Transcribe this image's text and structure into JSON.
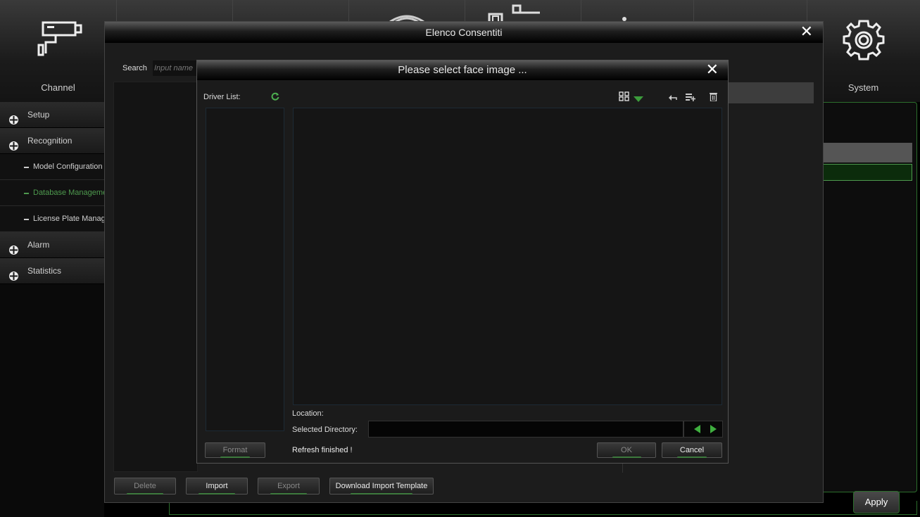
{
  "nav": {
    "channel_label": "Channel",
    "system_label": "System"
  },
  "sidebar": {
    "items": [
      {
        "label": "Setup"
      },
      {
        "label": "Recognition"
      },
      {
        "label": "Model Configuration"
      },
      {
        "label": "Database Management"
      },
      {
        "label": "License Plate Management"
      },
      {
        "label": "Alarm"
      },
      {
        "label": "Statistics"
      }
    ]
  },
  "outer_dialog": {
    "title": "Elenco Consentiti",
    "search_label": "Search",
    "search_placeholder": "Input name",
    "buttons": {
      "delete": "Delete",
      "import": "Import",
      "export": "Export",
      "download_template": "Download Import Template"
    }
  },
  "inner_dialog": {
    "title": "Please select face image ...",
    "driver_list_label": "Driver List:",
    "location_label": "Location:",
    "selected_directory_label": "Selected Directory:",
    "selected_directory_value": "",
    "status_text": "Refresh finished !",
    "format_button": "Format",
    "ok_button": "OK",
    "cancel_button": "Cancel"
  },
  "apply_button": "Apply",
  "colors": {
    "accent_green": "#4e9a4e",
    "title_bar": "#1e1e1e"
  }
}
